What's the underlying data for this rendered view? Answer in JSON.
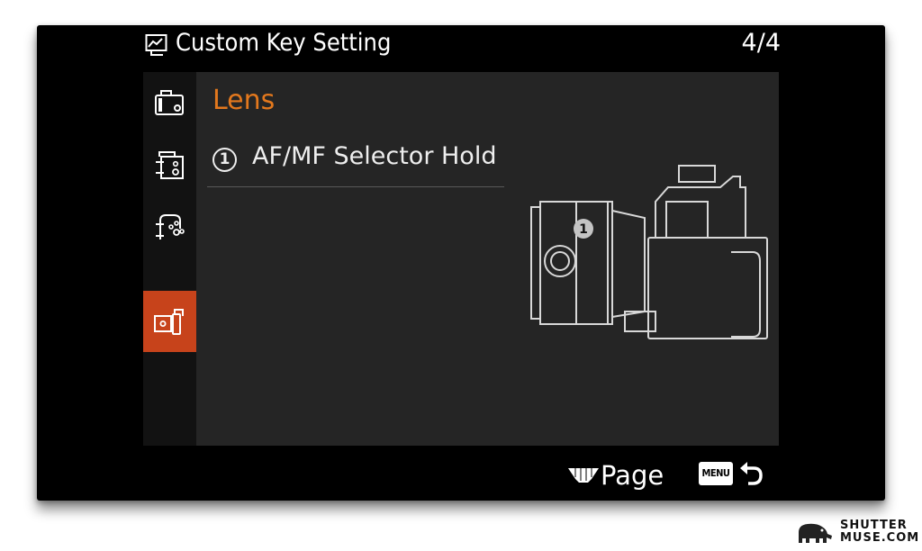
{
  "screen": {
    "title": "Custom Key Setting",
    "page_indicator": "4/4"
  },
  "sidebar": {
    "tabs": [
      {
        "name": "camera-front-tab",
        "icon": "camera-front-icon",
        "active": false
      },
      {
        "name": "camera-back-tab",
        "icon": "camera-back-icon",
        "active": false
      },
      {
        "name": "camera-controls-tab",
        "icon": "camera-controls-icon",
        "active": false
      },
      {
        "name": "lens-tab",
        "icon": "lens-icon",
        "active": true
      }
    ]
  },
  "main": {
    "section_title": "Lens",
    "items": [
      {
        "number": "1",
        "label": "AF/MF Selector Hold"
      }
    ],
    "illustration": {
      "icon": "camera-side-illustration",
      "marker": "1"
    }
  },
  "bottom_bar": {
    "page_label": "Page",
    "menu_key": "MENU",
    "dial_icon": "control-dial-icon",
    "back_icon": "return-icon"
  },
  "watermark": {
    "line1": "SHUTTER",
    "line2": "MUSE.COM"
  },
  "colors": {
    "accent": "#c7431b",
    "section_title": "#e3781d",
    "panel_bg": "#252525",
    "sidebar_bg": "#121212",
    "screen_bg": "#000000"
  }
}
